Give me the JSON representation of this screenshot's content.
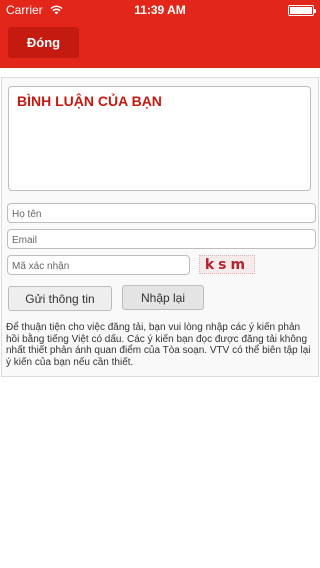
{
  "status_bar": {
    "carrier": "Carrier",
    "time": "11:39 AM"
  },
  "header": {
    "close_label": "Đóng",
    "color": "#e2261a"
  },
  "form": {
    "comment_title": "BÌNH LUẬN CỦA BẠN",
    "name_placeholder": "Họ tên",
    "email_placeholder": "Email",
    "captcha_placeholder": "Mã xác nhận",
    "captcha_text": "ksm",
    "submit_label": "Gửi thông tin",
    "reset_label": "Nhập lại",
    "note": "Để thuận tiện cho việc đăng tải, bạn vui lòng nhập các ý kiến phản hồi bằng tiếng Việt có dấu. Các ý kiến bạn đọc được đăng tải không nhất thiết phản ánh quan điểm của Tòa soạn. VTV có thể biên tập lại ý kiến của bạn nếu cần thiết."
  },
  "icons": {
    "wifi": "wifi-icon",
    "battery": "battery-icon"
  }
}
